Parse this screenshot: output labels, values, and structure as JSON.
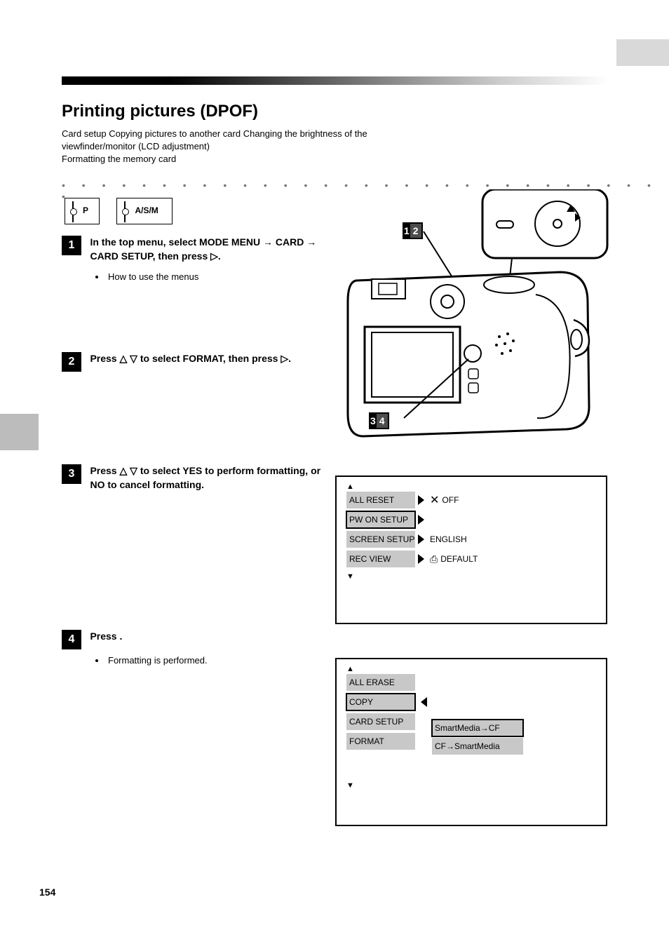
{
  "title": "Printing pictures (DPOF)",
  "subtitle": {
    "line1": "Card setup Copying pictures to another card Changing the brightness of the",
    "line1b": "viewfinder/monitor (LCD adjustment)",
    "line2": "Formatting the memory card"
  },
  "mode_icons": {
    "a": "P",
    "b": "A/S/M"
  },
  "steps": {
    "s1": {
      "text": "In the top menu, select MODE MENU → CARD → CARD SETUP, then press ",
      "text_tail": ".",
      "sub": "How to use the menus"
    },
    "s2": {
      "text_a": "Press ",
      "text_b": " to select ",
      "text_c": ", then press ",
      "text_d": "."
    },
    "s3": {
      "text_a": "Press ",
      "text_b": " to select YES to perform formatting, or NO to cancel formatting."
    },
    "s4": {
      "text": "Press ",
      "text_tail": ".",
      "sub": "Formatting is performed."
    }
  },
  "format_icon": "FORMAT",
  "callouts": {
    "c1a": "1",
    "c1b": "2",
    "c2a": "3",
    "c2b": "4"
  },
  "lcd1": {
    "rows": [
      {
        "label": "ALL RESET",
        "right": "OFF",
        "selected": false
      },
      {
        "label": "PW ON SETUP",
        "right": "",
        "selected": true
      },
      {
        "label": "SCREEN SETUP",
        "right": "ENGLISH",
        "selected": false
      },
      {
        "label": "REC VIEW",
        "right": "",
        "selected": false
      }
    ],
    "defprint": "DEFAULT"
  },
  "lcd2": {
    "rows": [
      {
        "label": "ALL ERASE",
        "selected": false
      },
      {
        "label": "COPY",
        "selected": true
      },
      {
        "label": "CARD SETUP",
        "selected": false
      },
      {
        "label": "FORMAT",
        "selected": false
      }
    ],
    "sub_options": [
      {
        "label": "SmartMedia→CF",
        "selected": true
      },
      {
        "label": "CF→SmartMedia",
        "selected": false
      }
    ]
  },
  "page_number": "154"
}
